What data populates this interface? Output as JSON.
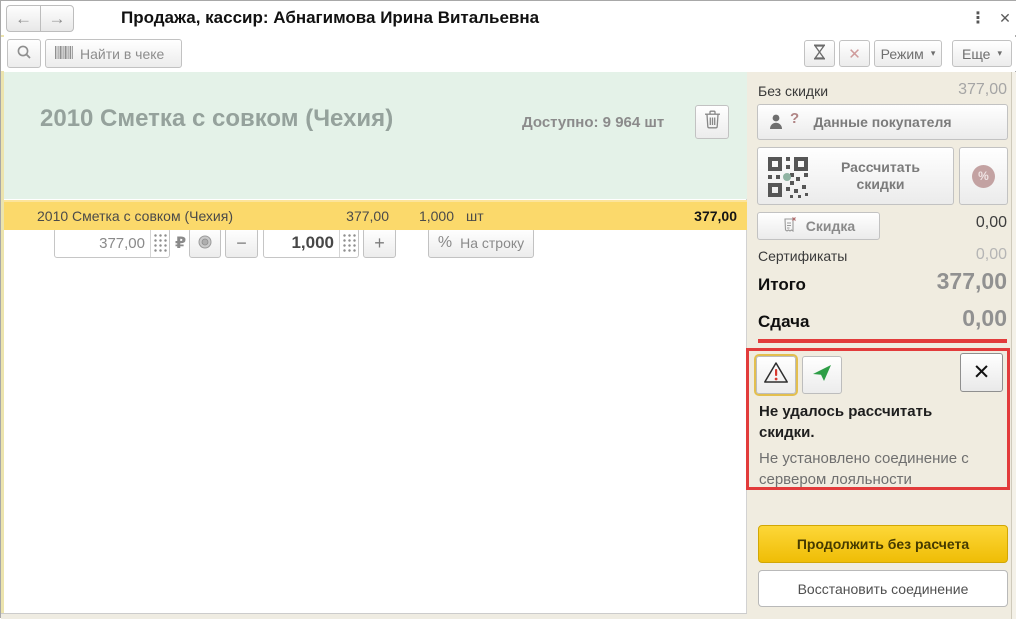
{
  "titlebar": {
    "title": "Продажа, кассир: Абнагимова Ирина Витальевна"
  },
  "toolbar": {
    "find_label": "Найти в чеке",
    "mode_label": "Режим",
    "more_label": "Еще"
  },
  "icons": {
    "back": "←",
    "forward": "→",
    "kebab": "⋮",
    "close": "✕",
    "dropdown": "▾",
    "minus": "−",
    "plus": "+",
    "percent": "%",
    "ruble": "₽",
    "question": "?",
    "cancel": "✕"
  },
  "product": {
    "name": "2010 Сметка с совком (Чехия)",
    "available": "Доступно: 9 964 шт",
    "price": "377,00",
    "quantity": "1,000",
    "per_line_label": "На строку"
  },
  "receipt": {
    "rows": [
      {
        "name": "2010 Сметка с совком (Чехия)",
        "price": "377,00",
        "qty": "1,000",
        "unit": "шт",
        "sum": "377,00"
      }
    ]
  },
  "summary": {
    "no_discount_label": "Без скидки",
    "no_discount_value": "377,00",
    "customer_data_label": "Данные покупателя",
    "calc_discounts_label": "Рассчитать скидки",
    "discount_label": "Скидка",
    "discount_value": "0,00",
    "certificates_label": "Сертификаты",
    "certificates_value": "0,00",
    "total_label": "Итого",
    "total_value": "377,00",
    "change_label": "Сдача",
    "change_value": "0,00"
  },
  "notification": {
    "title": "Не удалось рассчитать скидки.",
    "message": "Не установлено соединение с сервером лояльности"
  },
  "actions": {
    "continue_label": "Продолжить без расчета",
    "reconnect_label": "Восстановить соединение"
  },
  "colors": {
    "accent_red": "#e23b3b",
    "row_highlight": "#fbd96b",
    "panel_bg": "#f0ece0",
    "product_bg": "#e4f2e8",
    "primary_yellow": "#f6c90f",
    "send_green": "#2e9e47"
  }
}
